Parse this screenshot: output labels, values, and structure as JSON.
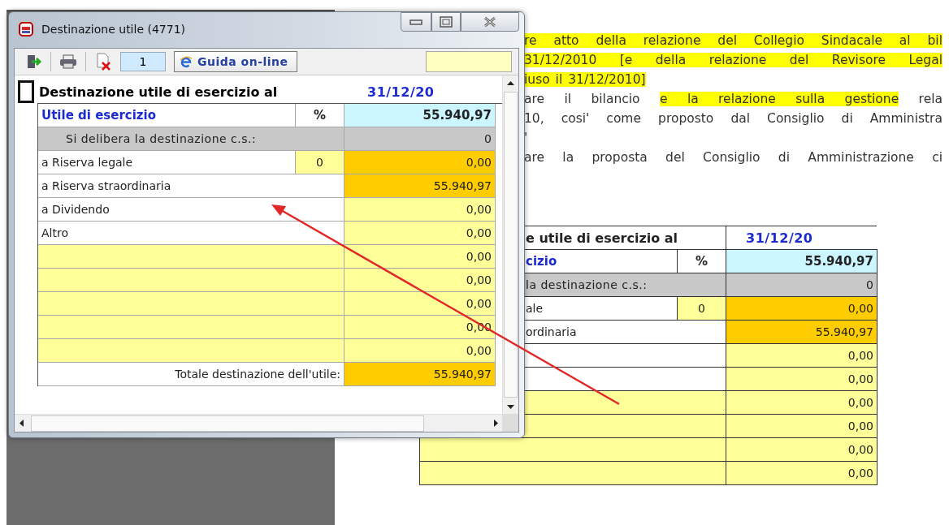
{
  "dialog": {
    "title": "Destinazione utile (4771)",
    "page_field": "1",
    "help_button": "Guida on-line",
    "sheet": {
      "heading": "Destinazione utile di esercizio al",
      "date": "31/12/20",
      "rows": [
        {
          "kind": "profit",
          "label": "Utile di esercizio",
          "percent": "%",
          "value": "55.940,97"
        },
        {
          "kind": "section",
          "label": "Si delibera la destinazione c.s.:",
          "value": "0"
        },
        {
          "kind": "percent",
          "label": "a Riserva legale",
          "percent": "0",
          "value": "0,00"
        },
        {
          "kind": "main",
          "label": "a Riserva straordinaria",
          "value": "55.940,97"
        },
        {
          "kind": "item",
          "label": "a Dividendo",
          "value": "0,00"
        },
        {
          "kind": "item",
          "label": "Altro",
          "value": "0,00"
        },
        {
          "kind": "blank",
          "value": "0,00"
        },
        {
          "kind": "blank",
          "value": "0,00"
        },
        {
          "kind": "blank",
          "value": "0,00"
        },
        {
          "kind": "blank",
          "value": "0,00"
        },
        {
          "kind": "blank",
          "value": "0,00"
        },
        {
          "kind": "total",
          "label": "Totale destinazione dell'utile:",
          "value": "55.940,97"
        }
      ]
    }
  },
  "document": {
    "lines": [
      {
        "kind": "full",
        "segments": [
          {
            "text": "re atto della relazione del Collegio Sindacale al bil",
            "highlighted": true
          }
        ]
      },
      {
        "kind": "full",
        "segments": [
          {
            "text": "31/12/2010 [e della relazione del Revisore Legal",
            "highlighted": true
          }
        ]
      },
      {
        "kind": "short",
        "segments": [
          {
            "text": "iuso il 31/12/2010]",
            "highlighted": true
          }
        ]
      },
      {
        "kind": "full",
        "segments": [
          {
            "text": "are il bilancio ",
            "highlighted": false
          },
          {
            "text": "e la relazione sulla gestione",
            "highlighted": true
          },
          {
            "text": " rela",
            "highlighted": false
          }
        ]
      },
      {
        "kind": "full",
        "segments": [
          {
            "text": "10, cosi' come proposto dal Consiglio di Amministra",
            "highlighted": false
          }
        ]
      },
      {
        "kind": "short",
        "segments": [
          {
            "text": "'",
            "highlighted": false
          }
        ]
      },
      {
        "kind": "full",
        "segments": [
          {
            "text": "are la proposta del Consiglio di Amministrazione ci",
            "highlighted": false
          }
        ]
      }
    ],
    "table": {
      "heading": "e utile di esercizio al",
      "date": "31/12/20",
      "rows": [
        {
          "kind": "profit",
          "label": "cizio",
          "percent": "%",
          "value": "55.940,97"
        },
        {
          "kind": "section",
          "label": "la destinazione c.s.:",
          "value": "0"
        },
        {
          "kind": "percent",
          "label": "ale",
          "percent": "0",
          "value": "0,00"
        },
        {
          "kind": "main",
          "label": "ordinaria",
          "value": "55.940,97"
        },
        {
          "kind": "item",
          "value": "0,00"
        },
        {
          "kind": "item",
          "value": "0,00"
        },
        {
          "kind": "blank",
          "value": "0,00"
        },
        {
          "kind": "blank",
          "value": "0,00"
        },
        {
          "kind": "blank",
          "value": "0,00"
        },
        {
          "kind": "blank",
          "value": "0,00"
        }
      ]
    }
  }
}
